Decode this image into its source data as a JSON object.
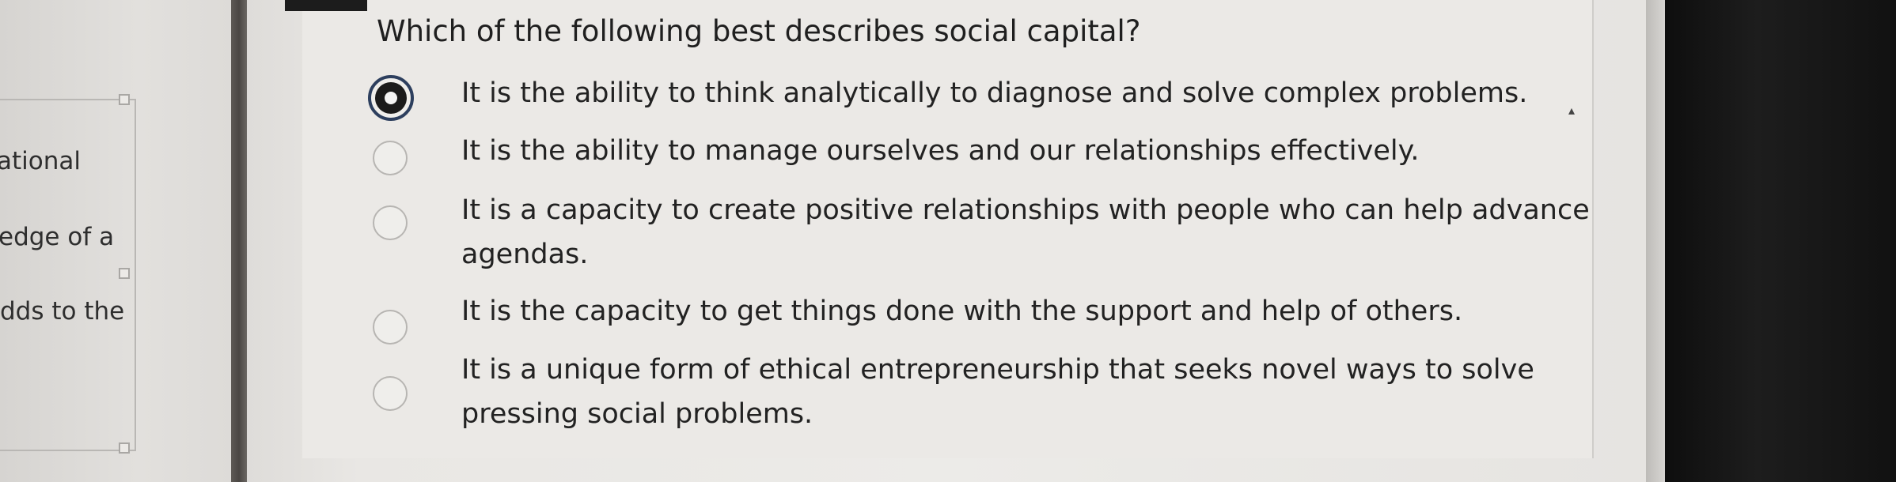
{
  "sidebar": {
    "fragments": [
      "ational",
      "edge of a",
      "dds to the"
    ]
  },
  "quiz": {
    "question": "Which of the following best describes social capital?",
    "selected_index": 0,
    "options": [
      {
        "text": "It is the ability to think analytically to diagnose and solve complex problems."
      },
      {
        "text": "It is the ability to manage ourselves and our relationships effectively."
      },
      {
        "text": "It is a capacity to create positive relationships with people who can help advance agendas."
      },
      {
        "text": "It is the capacity to get things done with the support and help of others."
      },
      {
        "text": "It is a unique form of ethical entrepreneurship that seeks novel ways to solve pressing social problems."
      }
    ]
  },
  "colors": {
    "selected_ring": "#2d3f5e",
    "background": "#ebe9e6",
    "text": "#222222"
  }
}
